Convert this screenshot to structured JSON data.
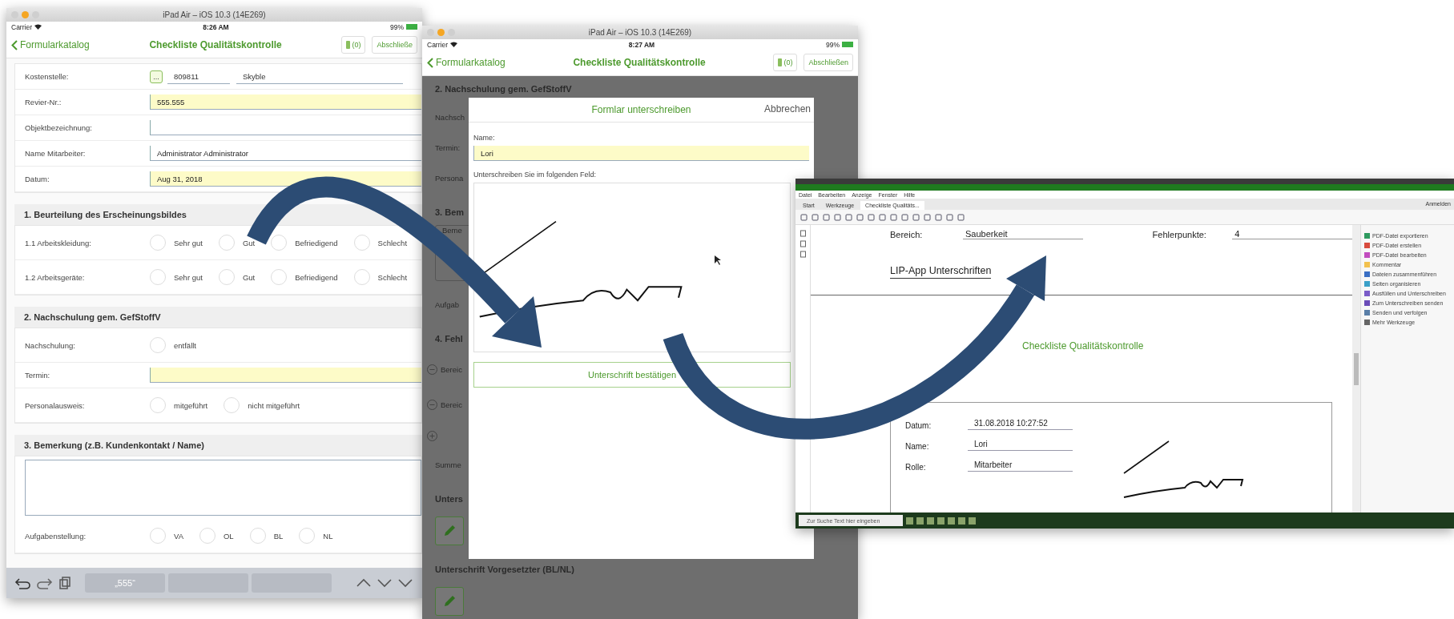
{
  "left_simulator": {
    "title": "iPad Air – iOS 10.3 (14E269)",
    "carrier": "Carrier",
    "time": "8:26 AM",
    "battery": "99%",
    "back": "Formularkatalog",
    "nav_title": "Checkliste Qualitätskontrolle",
    "attachments": "(0)",
    "finish": "Abschließe",
    "header_fields": [
      {
        "kind": "lookup",
        "label": "Kostenstelle:",
        "button": "...",
        "values": [
          "809811",
          "Skyble"
        ]
      },
      {
        "kind": "text",
        "label": "Revier-Nr.:",
        "value": "555.555",
        "highlighted": true
      },
      {
        "kind": "text",
        "label": "Objektbezeichnung:",
        "highlighted": false
      },
      {
        "kind": "text",
        "label": "Name Mitarbeiter:",
        "value": "Administrator Administrator",
        "highlighted": false
      },
      {
        "kind": "text",
        "label": "Datum:",
        "value": "Aug 31, 2018",
        "highlighted": true
      }
    ],
    "sections": [
      {
        "title": "1. Beurteilung des Erscheinungsbildes",
        "rows": [
          {
            "kind": "radio",
            "label": "1.1 Arbeitskleidung:",
            "options": [
              {
                "label": "Sehr gut",
                "selected": false
              },
              {
                "label": "Gut",
                "selected": false
              },
              {
                "label": "Befriedigend",
                "selected": false
              },
              {
                "label": "Schlecht",
                "selected": false
              }
            ]
          },
          {
            "kind": "radio",
            "label": "1.2 Arbeitsgeräte:",
            "options": [
              {
                "label": "Sehr gut",
                "selected": false
              },
              {
                "label": "Gut",
                "selected": false
              },
              {
                "label": "Befriedigend",
                "selected": false
              },
              {
                "label": "Schlecht",
                "selected": false
              }
            ]
          }
        ]
      },
      {
        "title": "2. Nachschulung gem. GefStoffV",
        "rows": [
          {
            "kind": "radio",
            "label": "Nachschulung:",
            "options": [
              {
                "label": "entfällt",
                "selected": false
              }
            ]
          },
          {
            "kind": "text",
            "label": "Termin:",
            "highlighted": true
          },
          {
            "kind": "radio",
            "label": "Personalausweis:",
            "options": [
              {
                "label": "mitgeführt",
                "selected": false
              },
              {
                "label": "nicht mitgeführt",
                "selected": false
              }
            ]
          }
        ]
      },
      {
        "title": "3. Bemerkung (z.B. Kundenkontakt / Name)",
        "rows": [
          {
            "kind": "textarea"
          },
          {
            "kind": "radio",
            "label": "Aufgabenstellung:",
            "options": [
              {
                "label": "VA",
                "selected": false
              },
              {
                "label": "OL",
                "selected": false
              },
              {
                "label": "BL",
                "selected": false
              },
              {
                "label": "NL",
                "selected": false
              }
            ]
          }
        ]
      }
    ],
    "suggestion": "„555“"
  },
  "right_simulator": {
    "title": "iPad Air – iOS 10.3 (14E269)",
    "carrier": "Carrier",
    "time": "8:27 AM",
    "battery": "99%",
    "back": "Formularkatalog",
    "nav_title": "Checkliste Qualitätskontrolle",
    "attachments": "(0)",
    "finish": "Abschließen",
    "background_rows": [
      {
        "kind": "header",
        "text": "2. Nachschulung gem. GefStoffV"
      },
      {
        "kind": "label",
        "text": "Nachsch"
      },
      {
        "kind": "label",
        "text": "Termin:"
      },
      {
        "kind": "label",
        "text": "Persona"
      },
      {
        "kind": "header",
        "text": "3. Bem"
      },
      {
        "kind": "textarea",
        "text": "Beme"
      },
      {
        "kind": "label",
        "text": "Aufgab"
      },
      {
        "kind": "header",
        "text": "4. Fehl"
      },
      {
        "kind": "removable",
        "text": "Bereic"
      },
      {
        "kind": "removable",
        "text": "Bereic"
      },
      {
        "kind": "add"
      },
      {
        "kind": "label",
        "text": "Summe"
      },
      {
        "kind": "header",
        "text": "Unters"
      },
      {
        "kind": "pencil"
      },
      {
        "kind": "header",
        "text": "Unterschrift Vorgesetzter (BL/NL)"
      },
      {
        "kind": "pencil"
      }
    ],
    "dialog": {
      "title": "Formlar unterschreiben",
      "cancel": "Abbrechen",
      "name_label": "Name:",
      "name_value": "Lori",
      "sign_label": "Unterschreiben Sie im folgenden Feld:",
      "confirm": "Unterschrift bestätigen"
    }
  },
  "pdf_viewer": {
    "menu": [
      "Datei",
      "Bearbeiten",
      "Anzeige",
      "Fenster",
      "Hilfe"
    ],
    "tabs": [
      {
        "label": "Start",
        "selected": false
      },
      {
        "label": "Werkzeuge",
        "selected": false
      },
      {
        "label": "Checkliste Qualitäts...",
        "selected": true
      }
    ],
    "sign_in": "Anmelden",
    "document": {
      "area_label": "Bereich:",
      "area_value": "Sauberkeit",
      "points_label": "Fehlerpunkte:",
      "points_value": "4",
      "heading": "LIP-App Unterschriften",
      "title": "Checkliste Qualitätskontrolle",
      "fields": [
        {
          "label": "Datum:",
          "value": "31.08.2018 10:27:52"
        },
        {
          "label": "Name:",
          "value": "Lori"
        },
        {
          "label": "Rolle:",
          "value": "Mitarbeiter"
        }
      ]
    },
    "tools": [
      {
        "label": "PDF-Datei exportieren",
        "color": "#2e9a5f"
      },
      {
        "label": "PDF-Datei erstellen",
        "color": "#d84b3e"
      },
      {
        "label": "PDF-Datei bearbeiten",
        "color": "#c24dbf"
      },
      {
        "label": "Kommentar",
        "color": "#f2c14e"
      },
      {
        "label": "Dateien zusammenführen",
        "color": "#3a6fc4"
      },
      {
        "label": "Seiten organisieren",
        "color": "#3aa0c8"
      },
      {
        "label": "Ausfüllen und Unterschreiben",
        "color": "#7a5cc8"
      },
      {
        "label": "Zum Unterschreiben senden",
        "color": "#6a4cb8"
      },
      {
        "label": "Senden und verfolgen",
        "color": "#5a7fa8"
      },
      {
        "label": "Mehr Werkzeuge",
        "color": "#666666"
      }
    ],
    "taskbar_search": "Zur Suche Text hier eingeben"
  }
}
